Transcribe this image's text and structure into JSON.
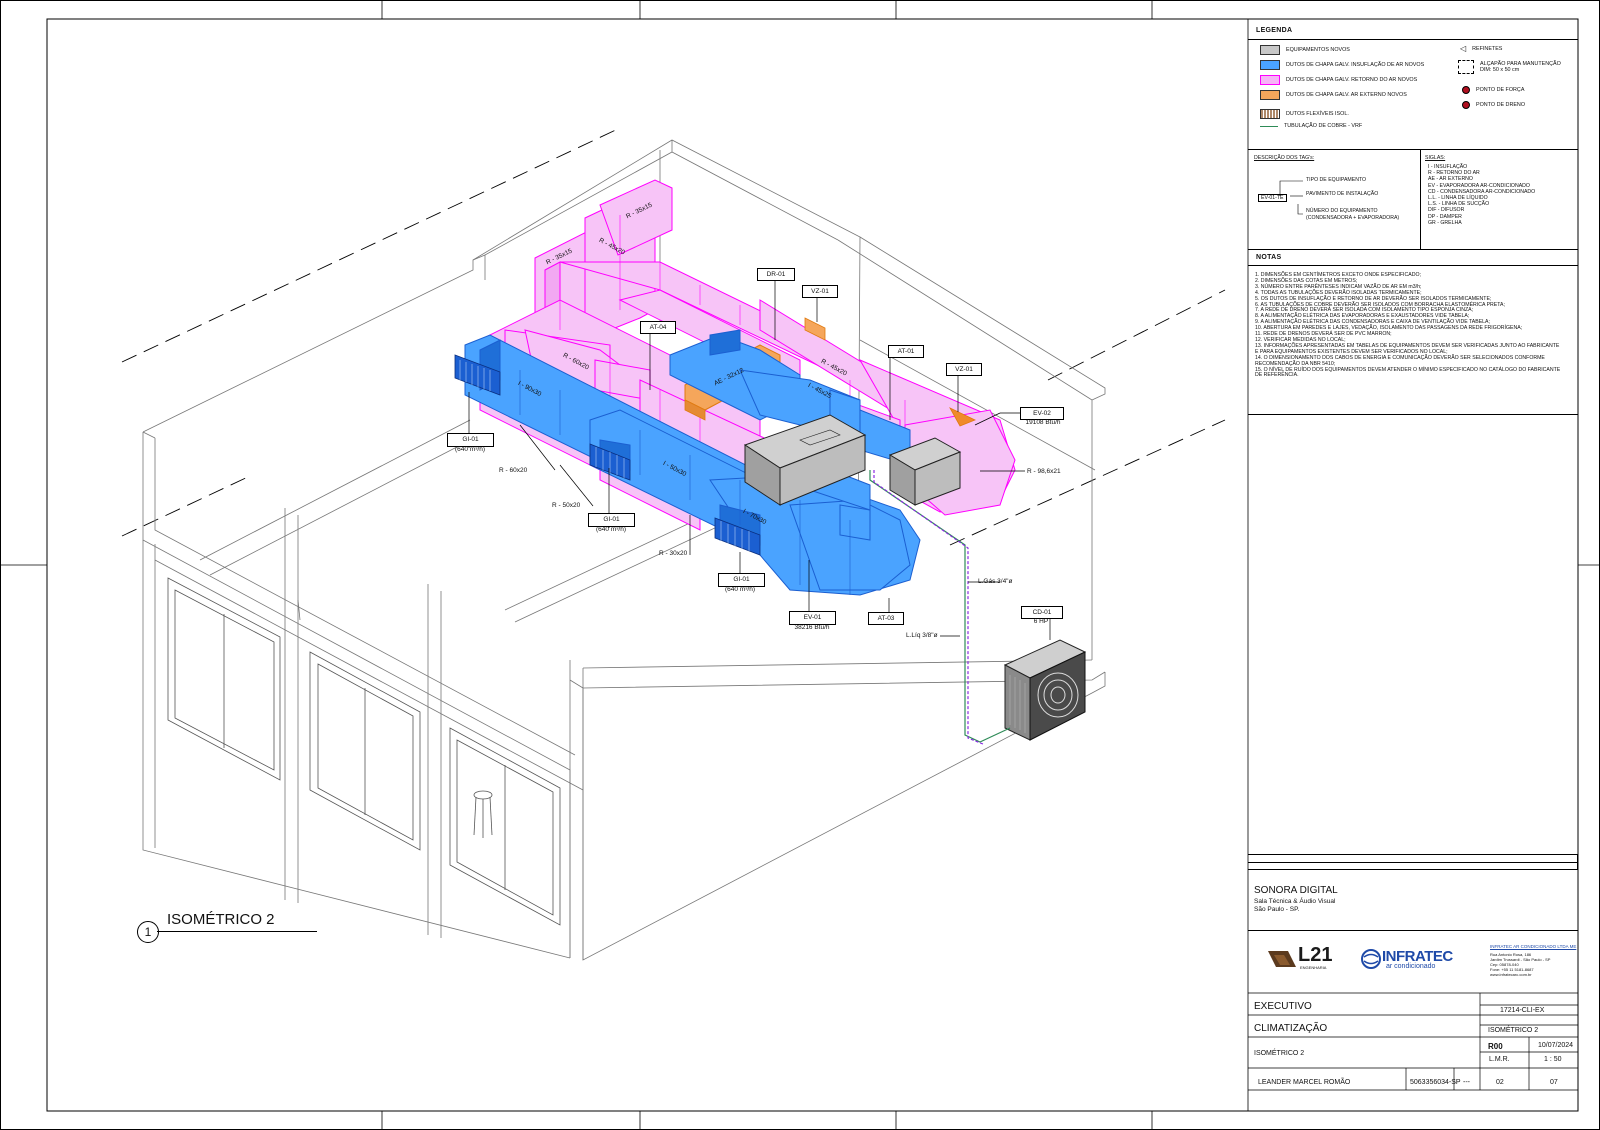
{
  "drawing": {
    "view_number": "1",
    "view_title": "ISOMÉTRICO 2"
  },
  "tags": [
    {
      "id": "gi1",
      "tag": "GI-01",
      "sub": "(640 m³/h)"
    },
    {
      "id": "gi2",
      "tag": "GI-01",
      "sub": "(640 m³/h)"
    },
    {
      "id": "gi3",
      "tag": "GI-01",
      "sub": "(640 m³/h)"
    },
    {
      "id": "ev1",
      "tag": "EV-01",
      "sub": "38216 Btu/h"
    },
    {
      "id": "ev2",
      "tag": "EV-02",
      "sub": "19108 Btu/h"
    },
    {
      "id": "cd1",
      "tag": "CD-01",
      "sub": "6 HP"
    },
    {
      "id": "at3",
      "tag": "AT-03",
      "sub": ""
    },
    {
      "id": "at4",
      "tag": "AT-04",
      "sub": ""
    },
    {
      "id": "at1",
      "tag": "AT-01",
      "sub": ""
    },
    {
      "id": "dr1",
      "tag": "DR-01",
      "sub": ""
    },
    {
      "id": "vz1a",
      "tag": "VZ-01",
      "sub": ""
    },
    {
      "id": "vz1b",
      "tag": "VZ-01",
      "sub": ""
    }
  ],
  "duct_labels": {
    "r60x20_top": "R - 60x20",
    "r60x20_side": "R - 60x20",
    "r50x20": "R - 50x20",
    "r30x20": "R - 30x20",
    "r45x20_top": "R - 45x20",
    "r45x20_right": "R - 45x20",
    "r35x15_a": "R - 35x15",
    "r35x15_b": "R - 35x15",
    "r98": "R - 98,6x21",
    "i90": "I - 90x30",
    "i50": "I - 50x30",
    "i70": "I - 70x30",
    "i45": "I - 45x25",
    "ae": "AE - 32x12",
    "lgas": "L.Gás  3/4\"ø",
    "lliq": "L.Líq  3/8\"ø"
  },
  "legend": {
    "title": "LEGENDA",
    "items": [
      {
        "label": "EQUIPAMENTOS NOVOS",
        "color": "#c8c8c8"
      },
      {
        "label": "DUTOS DE CHAPA GALV. INSUFLAÇÃO DE AR NOVOS",
        "color": "#4aa3ff"
      },
      {
        "label": "DUTOS DE CHAPA GALV. RETORNO DO AR NOVOS",
        "color": "#f7b3f7"
      },
      {
        "label": "DUTOS DE CHAPA GALV. AR EXTERNO NOVOS",
        "color": "#f5a65b"
      },
      {
        "label": "DUTOS FLEXÍVEIS ISOL.",
        "color": "#b08a6a"
      },
      {
        "label": "TUBULAÇÃO DE  COBRE - VRF",
        "color": "#2e8b57"
      }
    ],
    "right_items": [
      {
        "label": "REFINETES"
      },
      {
        "label": "ALÇAPÃO PARA MANUTENÇÃO",
        "sub": "DIM: 50 x 50 cm"
      },
      {
        "label": "PONTO DE FORÇA"
      },
      {
        "label": "PONTO DE DRENO"
      }
    ]
  },
  "tag_description": {
    "title": "DESCRIÇÃO DOS TAG's:",
    "sample": "EV-01-TE",
    "lines": [
      "TIPO DE EQUIPAMENTO",
      "PAVIMENTO DE INSTALAÇÃO",
      "NÚMERO DO EQUIPAMENTO",
      "(CONDENSADORA + EVAPORADORA)"
    ]
  },
  "siglas": {
    "title": "SIGLAS:",
    "items": [
      "I     - INSUFLAÇÃO",
      "R     - RETORNO DO AR",
      "AE   - AR EXTERNO",
      "EV   - EVAPORADORA AR-CONDICIONADO",
      "CD   - CONDENSADORA AR-CONDICIONADO",
      "L.L.  - LINHA DE LÍQUIDO",
      "L.S.  - LINHA DE SUCÇÃO",
      "DIF   - DIFUSOR",
      "DP   - DAMPER",
      "GR   - GRELHA"
    ]
  },
  "notes": {
    "title": "NOTAS",
    "items": [
      "1.    DIMENSÕES EM CENTÍMETROS EXCETO ONDE ESPECIFICADO;",
      "2.    DIMENSÕES DAS COTAS EM METROS;",
      "3.    NÚMERO ENTRE PARÊNTESES INDICAM VAZÃO DE AR EM m3/h;",
      "4.    TODAS AS TUBULAÇÕES DEVERÃO ISOLADAS TERMICAMENTE;",
      "5.    OS DUTOS DE INSUFLAÇÃO E RETORNO DE AR DEVERÃO SER ISOLADOS TERMICAMENTE;",
      "6.    AS TUBULAÇÕES DE COBRE DEVERÃO SER ISOLADOS COM BORRACHA ELASTOMÉRICA PRETA;",
      "7.    A REDE DE DRENO DEVERÁ SER ISOLADA COM ISOLAMENTO TIPO ESPONJA CINZA;",
      "8.    A ALIMENTAÇÃO ELÉTRICA DAS EVAPORADORAS E EXAUSTADORES VIDE TABELA;",
      "9.    A ALIMENTAÇÃO ELÉTRICA DAS CONDENSADORAS E CAIXA DE VENTILAÇÃO VIDE TABELA;",
      "10.  ABERTURA EM PAREDES E LAJES, VEDAÇÃO, ISOLAMENTO DAS PASSAGENS DA REDE FRIGORÍGENA;",
      "11.  REDE DE DRENOS DEVERÁ SER DE PVC MARRON;",
      "12.  VERIFICAR MEDIDAS NO LOCAL;",
      "13.  INFORMAÇÕES APRESENTADAS EM TABELAS DE EQUIPAMENTOS DEVEM SER VERIFICADAS JUNTO AO FABRICANTE",
      "       E  PARA EQUIPAMENTOS EXISTENTES DEVEM SER VERIFICADOS NO LOCAL;",
      "14.  O DIMENSIONAMENTO DOS CABOS DE ENERGIA E COMUNICAÇÃO DEVERÃO SER SELECIONADOS CONFORME",
      "       RECOMENDAÇÃO DA NBR 5410;",
      "15.  O NÍVEL DE RUÍDO DOS EQUIPAMENTOS DEVEM ATENDER O MÍNIMO ESPECIFICADO NO CATÁLOGO DO FABRICANTE",
      "       DE REFERÊNCIA."
    ]
  },
  "title_block": {
    "client": "SONORA DIGITAL",
    "client_sub1": "Sala Técnica & Áudio Visual",
    "client_sub2": "São Paulo - SP.",
    "logo_l21": "L21",
    "logo_l21_sub": "ENGENHARIA",
    "logo_infratec": "INFRATEC",
    "logo_infratec_sub": "ar condicionado",
    "company_name": "INFRATEC AR CONDICIONADO LTDA ME",
    "company_addr": [
      "Rua Antonio Rosa, 186",
      "Jardim Trussardi - São Paulo - SP",
      "Cep: 05878-040",
      "Fone: +55 11 5181-8687",
      "www.infratecarc.com.br"
    ],
    "phase": "EXECUTIVO",
    "discipline": "CLIMATIZAÇÃO",
    "title": "ISOMÉTRICO 2",
    "file_name": "17214-CLI-EX",
    "sheet_name": "ISOMÉTRICO 2",
    "revision": "R00",
    "date": "10/07/2024",
    "drawn_by": "L.M.R.",
    "scale": "1 : 50",
    "engineer": "LEANDER MARCEL ROMÃO",
    "crea": "5063356034-SP",
    "art": "---",
    "sheet": "02",
    "total_sheets": "07"
  },
  "colors": {
    "supply": "#4aa3ff",
    "supply_stroke": "#1b5fd1",
    "return": "#f7c4f7",
    "return_stroke": "#ff00ff",
    "external": "#f5a65b",
    "equipment": "#c8c8c8",
    "copper": "#2e8b57"
  }
}
